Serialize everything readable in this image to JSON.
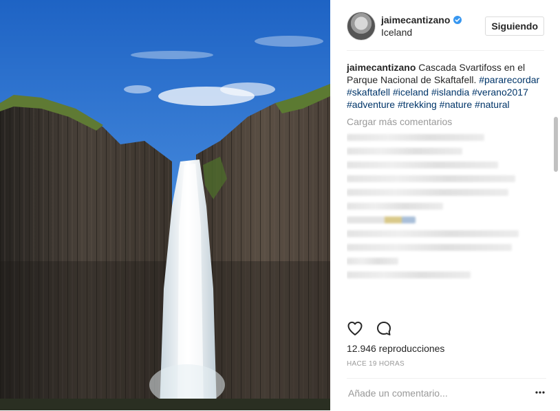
{
  "post": {
    "username": "jaimecantizano",
    "location": "Iceland",
    "follow_label": "Siguiendo",
    "verified": true
  },
  "caption": {
    "author": "jaimecantizano",
    "text": " Cascada Svartifoss en el Parque Nacional de Skaftafell. ",
    "hashtags": [
      "#pararecordar",
      "#skaftafell",
      "#iceland",
      "#islandia",
      "#verano2017",
      "#adventure",
      "#trekking",
      "#nature",
      "#natural"
    ]
  },
  "load_more_label": "Cargar más comentarios",
  "stats": {
    "views": "12.946 reproducciones",
    "time": "HACE 19 HORAS"
  },
  "comment_input": {
    "placeholder": "Añade un comentario..."
  },
  "icons": {
    "like": "heart-icon",
    "comment": "comment-bubble-icon",
    "verified": "verified-badge-icon",
    "more": "more-options-icon"
  },
  "colors": {
    "hashtag": "#003569",
    "verified": "#3897f0",
    "muted": "#999999"
  }
}
